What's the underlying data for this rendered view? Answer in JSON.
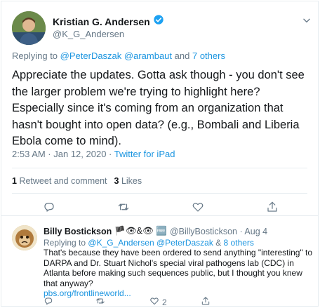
{
  "main_tweet": {
    "display_name": "Kristian G. Andersen",
    "handle": "@K_G_Andersen",
    "replying_label": "Replying to",
    "replying_users": "@PeterDaszak @arambaut",
    "replying_and": "and",
    "replying_others": "7 others",
    "text": "Appreciate the updates. Gotta ask though - you don't see the larger problem we're trying to highlight here? Especially since it's coming from an organization that hasn't bought into open data? (e.g., Bombali and Liberia Ebola come to mind).",
    "timestamp": "2:53 AM · Jan 12, 2020 · ",
    "source": "Twitter for iPad",
    "retweet_count": "1",
    "retweet_label": "Retweet and comment",
    "like_count": "3",
    "like_label": "Likes"
  },
  "reply_tweet": {
    "display_name": "Billy Bostickson",
    "name_emojis": "🏴👁&👁 🆓",
    "handle": "@BillyBostickson · Aug 4",
    "replying_label": "Replying to",
    "replying_users": "@K_G_Andersen @PeterDaszak",
    "replying_and": "&",
    "replying_others": "8 others",
    "text": "That's because they have been ordered to send anything \"interesting\" to DARPA and Dr. Stuart Nichol's special viral pathogens lab (CDC) in Atlanta before making such sequences public, but I thought you knew that anyway?",
    "link": "pbs.org/frontlineworld...",
    "retweet_count": "",
    "like_count": "2"
  },
  "colors": {
    "accent": "#1b95e0",
    "secondary_text": "#657786",
    "primary_text": "#14171a",
    "border": "#e6ecf0"
  },
  "icons": [
    "verified-badge-icon",
    "chevron-down-icon",
    "reply-icon",
    "retweet-icon",
    "like-icon",
    "share-icon"
  ]
}
